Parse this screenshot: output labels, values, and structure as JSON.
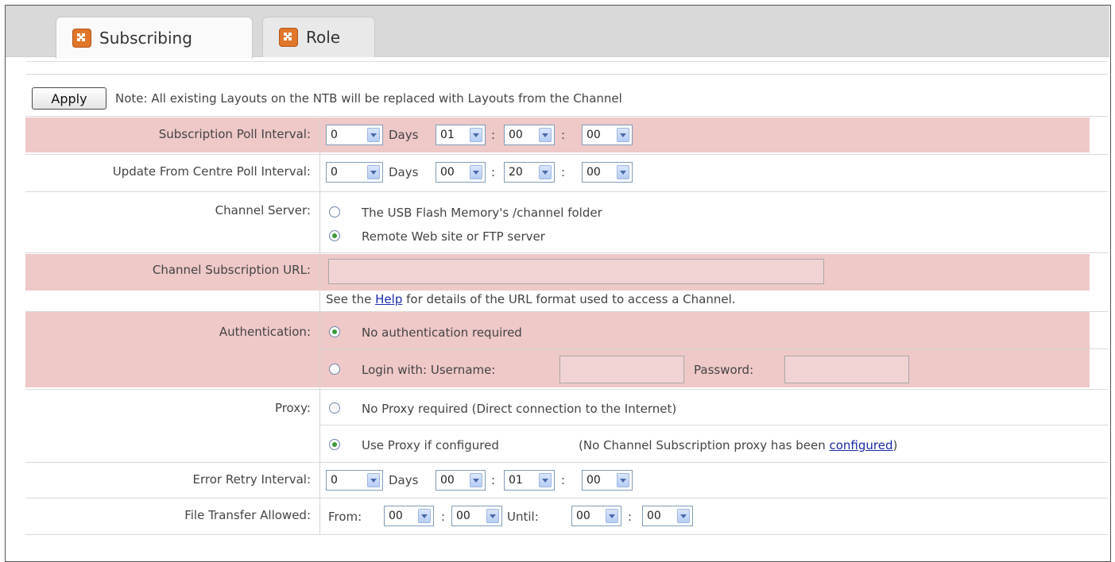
{
  "tabs": [
    {
      "label": "Subscribing",
      "icon": "app-icon",
      "active": true
    },
    {
      "label": "Role",
      "icon": "app-icon",
      "active": false
    }
  ],
  "apply_label": "Apply",
  "note": "Note: All existing Layouts on the NTB will be replaced with Layouts from the Channel",
  "sep_colon": ":",
  "days_label": "Days",
  "subscription_poll": {
    "label": "Subscription Poll Interval:",
    "days": "0",
    "h": "01",
    "m": "00",
    "s": "00"
  },
  "update_poll": {
    "label": "Update From Centre Poll Interval:",
    "days": "0",
    "h": "00",
    "m": "20",
    "s": "00"
  },
  "channel_server": {
    "label": "Channel Server:",
    "option1": "The USB Flash Memory's /channel folder",
    "option2": "Remote Web site or FTP server",
    "selected": 2
  },
  "channel_url": {
    "label": "Channel Subscription URL:",
    "value": "",
    "help_prefix": "See the",
    "help_link": "Help",
    "help_suffix": "for details of the URL format used to access a Channel."
  },
  "authentication": {
    "label": "Authentication:",
    "option1": "No authentication required",
    "option2": "Login with: Username:",
    "password_label": "Password:",
    "selected": 1
  },
  "proxy": {
    "label": "Proxy:",
    "option1": "No Proxy required (Direct connection to the Internet)",
    "option2": "Use Proxy if configured",
    "note_prefix": "(No Channel Subscription proxy has been",
    "note_link": "configured",
    "note_suffix": ")",
    "selected": 2
  },
  "error_retry": {
    "label": "Error Retry Interval:",
    "days": "0",
    "h": "00",
    "m": "01",
    "s": "00"
  },
  "file_transfer": {
    "label": "File Transfer Allowed:",
    "from_label": "From:",
    "until_label": "Until:",
    "from_h": "00",
    "from_m": "00",
    "until_h": "00",
    "until_m": "00"
  },
  "colors": {
    "highlight": "#efc8c8",
    "radio_selected": "#3a9a3a",
    "tab_icon": "#e0762a",
    "link": "#1a2aa8"
  }
}
